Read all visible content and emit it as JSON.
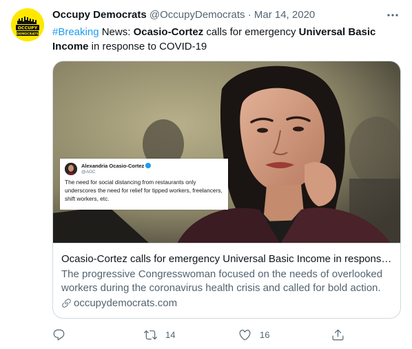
{
  "tweet": {
    "author_name": "Occupy Democrats",
    "handle": "@OccupyDemocrats",
    "separator": "·",
    "date": "Mar 14, 2020",
    "avatar_text": "OCCUPY DEMOCRATS",
    "text": {
      "hashtag": "#Breaking",
      "part1": " News: ",
      "bold1": "Ocasio-Cortez",
      "part2": " calls for emergency ",
      "bold2": "Universal Basic Income",
      "part3": " in response to COVID-19"
    }
  },
  "card": {
    "quote": {
      "name": "Alexandria Ocasio-Cortez",
      "handle": "@AOC",
      "text": "The need for social distancing from restaurants only underscores the need for relief for tipped workers, freelancers, shift workers, etc."
    },
    "title": "Ocasio-Cortez calls for emergency Universal Basic Income in response ...",
    "description": "The progressive Congresswoman focused on the needs of overlooked workers during the coronavirus health crisis and called for bold action.",
    "domain": "occupydemocrats.com"
  },
  "actions": {
    "reply": {
      "icon": "reply-icon",
      "count": ""
    },
    "retweet": {
      "icon": "retweet-icon",
      "count": "14"
    },
    "like": {
      "icon": "heart-icon",
      "count": "16"
    },
    "share": {
      "icon": "share-icon"
    }
  },
  "colors": {
    "link_blue": "#1d9bf0",
    "secondary_text": "#536471",
    "avatar_yellow": "#ffe800"
  }
}
